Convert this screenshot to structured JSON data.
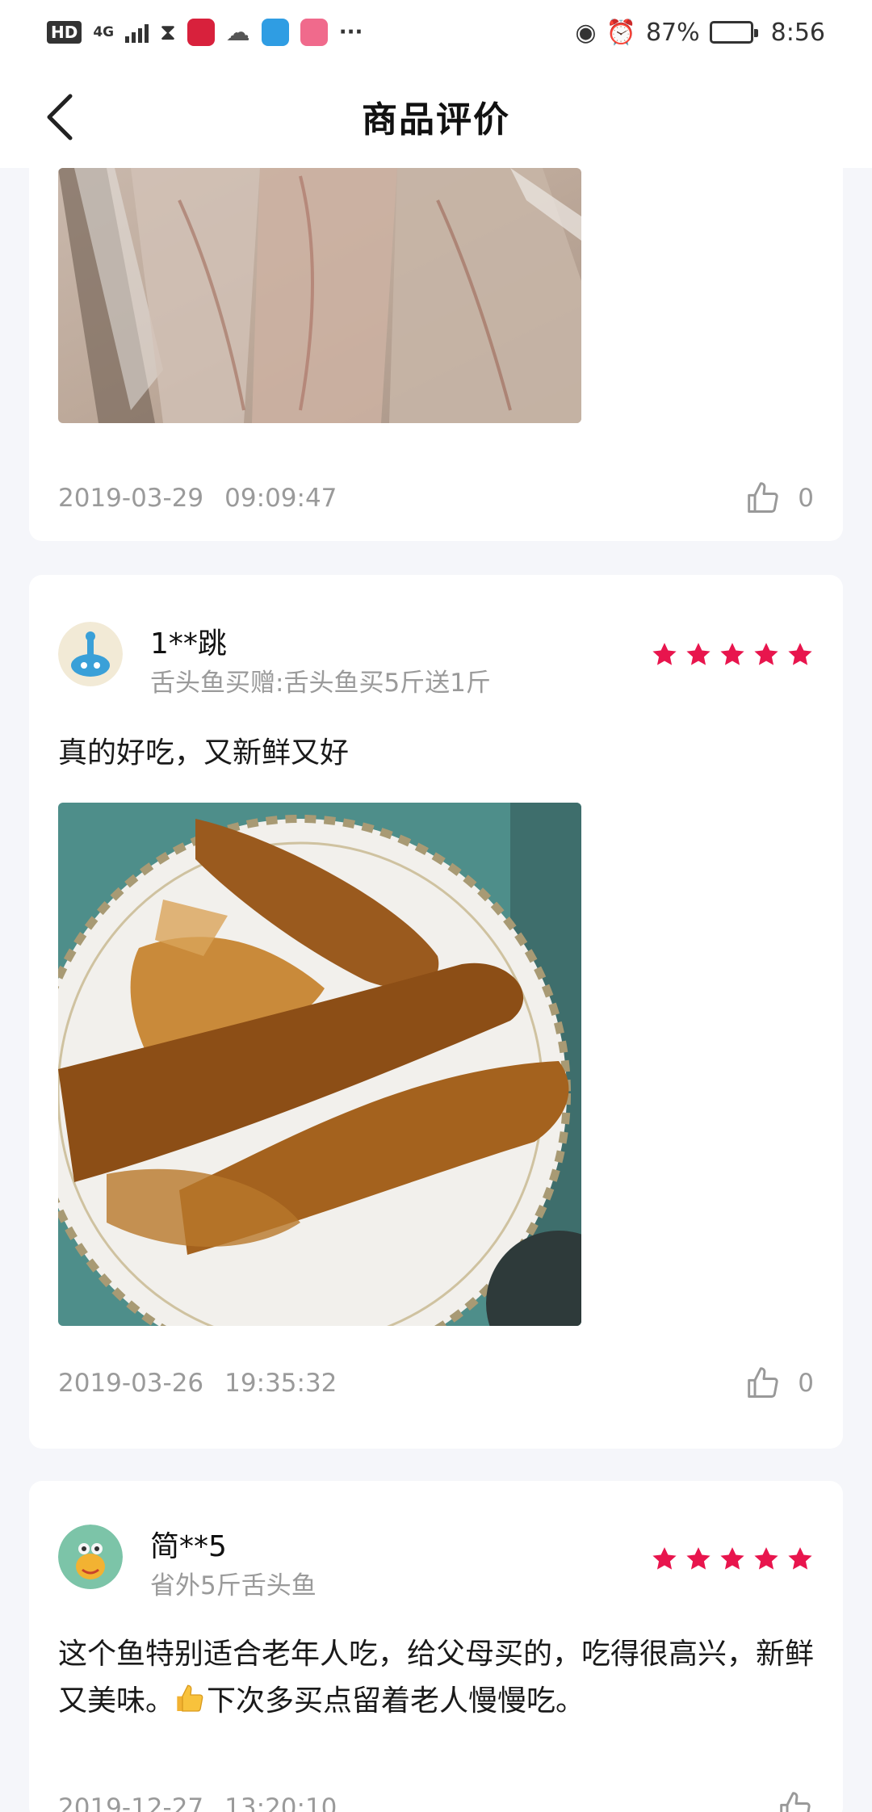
{
  "status_bar": {
    "hd": "HD",
    "network": "4G",
    "more": "···",
    "battery": "87%",
    "battery_level": 0.87,
    "time": "8:56"
  },
  "header": {
    "title": "商品评价"
  },
  "reviews": [
    {
      "date": "2019-03-29",
      "time": "09:09:47",
      "likes": "0"
    },
    {
      "user": "1**跳",
      "variant": "舌头鱼买赠:舌头鱼买5斤送1斤",
      "rating": 5,
      "text": "真的好吃，又新鲜又好",
      "date": "2019-03-26",
      "time": "19:35:32",
      "likes": "0"
    },
    {
      "user": "简**5",
      "variant": "省外5斤舌头鱼",
      "rating": 5,
      "text_before": "这个鱼特别适合老年人吃，给父母买的，吃得很高兴，新鲜又美味。",
      "text_after": "下次多买点留着老人慢慢吃。",
      "date": "2019-12-27",
      "time": "13:20:10"
    }
  ],
  "colors": {
    "star": "#e8154d",
    "meta_text": "#9a9a9a",
    "background": "#f5f6fa"
  }
}
